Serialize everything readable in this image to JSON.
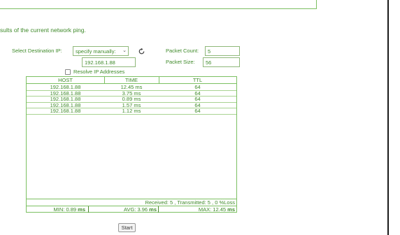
{
  "page": {
    "description": "sults of the current network ping."
  },
  "form": {
    "dest_ip_label": "Select Destination IP:",
    "dest_ip_select_value": "specify manually:",
    "dest_ip_input_value": "192.168.1.88",
    "packet_count_label": "Packet Count:",
    "packet_count_value": "5",
    "packet_size_label": "Packet Size:",
    "packet_size_value": "56",
    "resolve_label": "Resolve IP Addresses",
    "resolve_checked": false
  },
  "table": {
    "headers": [
      "HOST",
      "TIME",
      "TTL"
    ],
    "rows": [
      [
        "192.168.1.88",
        "12.45 ms",
        "64"
      ],
      [
        "192.168.1.88",
        "3.75 ms",
        "64"
      ],
      [
        "192.168.1.88",
        "0.89 ms",
        "64"
      ],
      [
        "192.168.1.88",
        "1.57 ms",
        "64"
      ],
      [
        "192.168.1.88",
        "1.12 ms",
        "64"
      ]
    ],
    "summary": "Received: 5 , Transmitted: 5 , 0 %Loss",
    "stats": {
      "min_label": "MIN: 0.89",
      "avg_label": "AVG: 3.96",
      "max_label": "MAX: 12.45",
      "unit": "ms"
    }
  },
  "actions": {
    "start_label": "Start"
  },
  "icons": {
    "refresh": "refresh-icon",
    "dropdown": "chevron-down-icon"
  },
  "colors": {
    "accent": "#4b8a2e",
    "border": "#7cc062"
  }
}
